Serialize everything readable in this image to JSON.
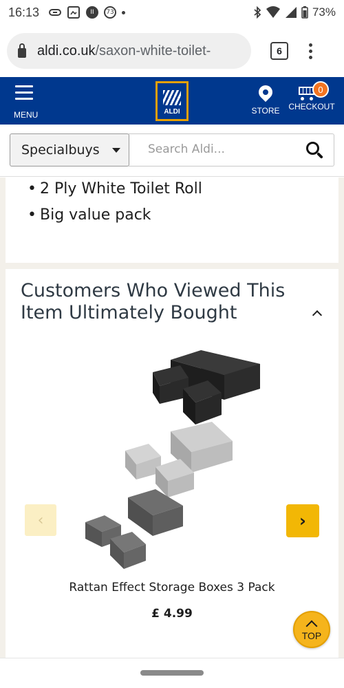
{
  "status_bar": {
    "time": "16:13",
    "notification_badge": "73",
    "battery": "73%"
  },
  "browser": {
    "url_domain": "aldi.co.uk",
    "url_path": "/saxon-white-toilet-",
    "tab_count": "6"
  },
  "header": {
    "menu_label": "MENU",
    "logo_text": "ALDI",
    "store_label": "STORE",
    "checkout_label": "CHECKOUT",
    "cart_count": "0",
    "brand_colors": {
      "header_bg": "#00388e",
      "logo_border": "#e8a000",
      "badge": "#f37421"
    }
  },
  "search": {
    "category": "Specialbuys",
    "placeholder": "Search Aldi..."
  },
  "product_features": [
    "2 Ply White Toilet Roll",
    "Big value pack"
  ],
  "recommendations": {
    "title": "Customers Who Viewed This Item Ultimately Bought",
    "item": {
      "name": "Rattan Effect Storage Boxes 3 Pack",
      "price": "£ 4.99"
    }
  },
  "top_button": {
    "label": "TOP"
  }
}
